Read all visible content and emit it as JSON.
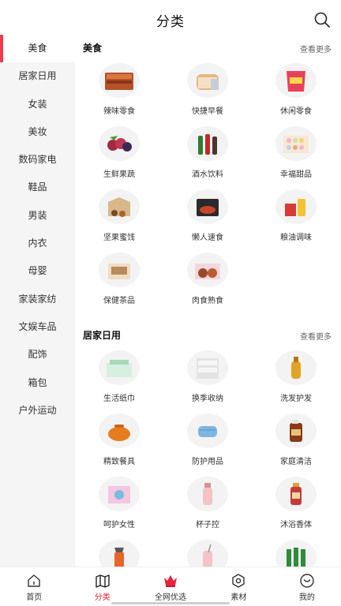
{
  "header": {
    "title": "分类"
  },
  "sidebar": {
    "items": [
      {
        "label": "美食"
      },
      {
        "label": "居家日用"
      },
      {
        "label": "女装"
      },
      {
        "label": "美妆"
      },
      {
        "label": "数码家电"
      },
      {
        "label": "鞋品"
      },
      {
        "label": "男装"
      },
      {
        "label": "内衣"
      },
      {
        "label": "母婴"
      },
      {
        "label": "家装家纺"
      },
      {
        "label": "文娱车品"
      },
      {
        "label": "配饰"
      },
      {
        "label": "箱包"
      },
      {
        "label": "户外运动"
      }
    ],
    "active": "美食"
  },
  "sections": [
    {
      "title": "美食",
      "more": "查看更多",
      "items": [
        {
          "label": "辣味零食",
          "icon": "spicy-snack-icon"
        },
        {
          "label": "快捷早餐",
          "icon": "bread-icon"
        },
        {
          "label": "休闲零食",
          "icon": "snack-bag-icon"
        },
        {
          "label": "生鲜果蔬",
          "icon": "fruit-icon"
        },
        {
          "label": "酒水饮料",
          "icon": "bottles-icon"
        },
        {
          "label": "幸福甜品",
          "icon": "macaron-icon"
        },
        {
          "label": "坚果蜜饯",
          "icon": "nut-box-icon"
        },
        {
          "label": "懒人速食",
          "icon": "instant-food-icon"
        },
        {
          "label": "粮油调味",
          "icon": "oil-rice-icon"
        },
        {
          "label": "保健茶品",
          "icon": "tea-box-icon"
        },
        {
          "label": "肉食熟食",
          "icon": "meat-icon"
        }
      ]
    },
    {
      "title": "居家日用",
      "more": "查看更多",
      "items": [
        {
          "label": "生活纸巾",
          "icon": "tissue-icon"
        },
        {
          "label": "换季收纳",
          "icon": "storage-drawer-icon"
        },
        {
          "label": "洗发护发",
          "icon": "shampoo-icon"
        },
        {
          "label": "精致餐具",
          "icon": "pot-icon"
        },
        {
          "label": "防护用品",
          "icon": "mask-icon"
        },
        {
          "label": "家庭清洁",
          "icon": "disinfectant-icon"
        },
        {
          "label": "呵护女性",
          "icon": "pad-icon"
        },
        {
          "label": "杯子控",
          "icon": "cup-icon"
        },
        {
          "label": "沐浴香体",
          "icon": "body-wash-icon"
        },
        {
          "label": "",
          "icon": "spray-cleaner-icon"
        },
        {
          "label": "",
          "icon": "pink-cup-icon"
        },
        {
          "label": "",
          "icon": "green-bottles-icon"
        }
      ]
    }
  ],
  "tabbar": {
    "items": [
      {
        "label": "首页"
      },
      {
        "label": "分类"
      },
      {
        "label": "全网优选"
      },
      {
        "label": "素材"
      },
      {
        "label": "我的"
      }
    ],
    "active": "分类"
  },
  "colors": {
    "accent": "#e8233b",
    "sidebar_bg": "#f5f5f5",
    "active_bar": "#f03a4e"
  }
}
